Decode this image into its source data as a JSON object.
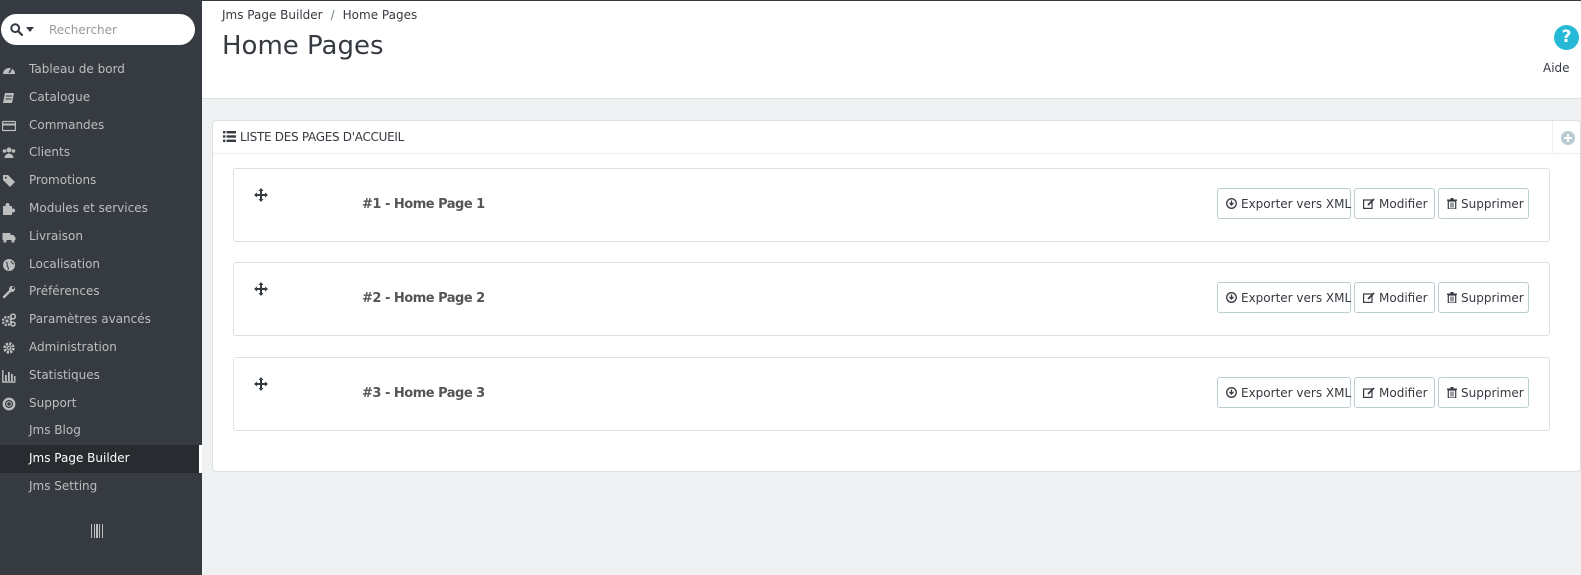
{
  "search": {
    "placeholder": "Rechercher"
  },
  "sidebar": {
    "items": [
      {
        "label": "Tableau de bord",
        "icon": "dashboard-icon"
      },
      {
        "label": "Catalogue",
        "icon": "book-icon"
      },
      {
        "label": "Commandes",
        "icon": "credit-card-icon"
      },
      {
        "label": "Clients",
        "icon": "users-icon"
      },
      {
        "label": "Promotions",
        "icon": "tags-icon"
      },
      {
        "label": "Modules et services",
        "icon": "puzzle-icon"
      },
      {
        "label": "Livraison",
        "icon": "truck-icon"
      },
      {
        "label": "Localisation",
        "icon": "globe-icon"
      },
      {
        "label": "Préférences",
        "icon": "wrench-icon"
      },
      {
        "label": "Paramètres avancés",
        "icon": "cogs-icon"
      },
      {
        "label": "Administration",
        "icon": "gear-icon"
      },
      {
        "label": "Statistiques",
        "icon": "bar-chart-icon"
      },
      {
        "label": "Support",
        "icon": "lifebuoy-icon"
      },
      {
        "label": "Jms Blog",
        "icon": ""
      },
      {
        "label": "Jms Page Builder",
        "icon": "",
        "active": true
      },
      {
        "label": "Jms Setting",
        "icon": ""
      }
    ]
  },
  "breadcrumb": {
    "parent": "Jms Page Builder",
    "separator": "/",
    "current": "Home Pages"
  },
  "header": {
    "title": "Home Pages",
    "help_label": "Aide",
    "help_symbol": "?"
  },
  "panel": {
    "title": "LISTE DES PAGES D'ACCUEIL",
    "rows": [
      {
        "title": "#1 - Home Page 1"
      },
      {
        "title": "#2 - Home Page 2"
      },
      {
        "title": "#3 - Home Page 3"
      }
    ],
    "buttons": {
      "export": "Exporter vers XML",
      "edit": "Modifier",
      "delete": "Supprimer"
    }
  },
  "colors": {
    "sidebar": "#363a41",
    "sidebar_active": "#282b30",
    "help": "#25b9d7",
    "background": "#eff1f2"
  }
}
